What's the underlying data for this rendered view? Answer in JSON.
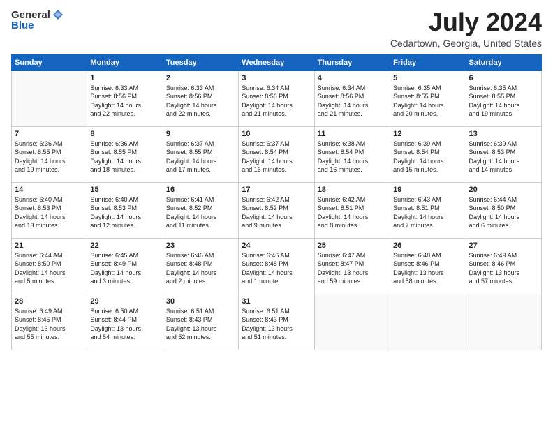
{
  "logo": {
    "general": "General",
    "blue": "Blue"
  },
  "header": {
    "month": "July 2024",
    "location": "Cedartown, Georgia, United States"
  },
  "weekdays": [
    "Sunday",
    "Monday",
    "Tuesday",
    "Wednesday",
    "Thursday",
    "Friday",
    "Saturday"
  ],
  "weeks": [
    [
      {
        "day": "",
        "info": ""
      },
      {
        "day": "1",
        "info": "Sunrise: 6:33 AM\nSunset: 8:56 PM\nDaylight: 14 hours\nand 22 minutes."
      },
      {
        "day": "2",
        "info": "Sunrise: 6:33 AM\nSunset: 8:56 PM\nDaylight: 14 hours\nand 22 minutes."
      },
      {
        "day": "3",
        "info": "Sunrise: 6:34 AM\nSunset: 8:56 PM\nDaylight: 14 hours\nand 21 minutes."
      },
      {
        "day": "4",
        "info": "Sunrise: 6:34 AM\nSunset: 8:56 PM\nDaylight: 14 hours\nand 21 minutes."
      },
      {
        "day": "5",
        "info": "Sunrise: 6:35 AM\nSunset: 8:55 PM\nDaylight: 14 hours\nand 20 minutes."
      },
      {
        "day": "6",
        "info": "Sunrise: 6:35 AM\nSunset: 8:55 PM\nDaylight: 14 hours\nand 19 minutes."
      }
    ],
    [
      {
        "day": "7",
        "info": "Sunrise: 6:36 AM\nSunset: 8:55 PM\nDaylight: 14 hours\nand 19 minutes."
      },
      {
        "day": "8",
        "info": "Sunrise: 6:36 AM\nSunset: 8:55 PM\nDaylight: 14 hours\nand 18 minutes."
      },
      {
        "day": "9",
        "info": "Sunrise: 6:37 AM\nSunset: 8:55 PM\nDaylight: 14 hours\nand 17 minutes."
      },
      {
        "day": "10",
        "info": "Sunrise: 6:37 AM\nSunset: 8:54 PM\nDaylight: 14 hours\nand 16 minutes."
      },
      {
        "day": "11",
        "info": "Sunrise: 6:38 AM\nSunset: 8:54 PM\nDaylight: 14 hours\nand 16 minutes."
      },
      {
        "day": "12",
        "info": "Sunrise: 6:39 AM\nSunset: 8:54 PM\nDaylight: 14 hours\nand 15 minutes."
      },
      {
        "day": "13",
        "info": "Sunrise: 6:39 AM\nSunset: 8:53 PM\nDaylight: 14 hours\nand 14 minutes."
      }
    ],
    [
      {
        "day": "14",
        "info": "Sunrise: 6:40 AM\nSunset: 8:53 PM\nDaylight: 14 hours\nand 13 minutes."
      },
      {
        "day": "15",
        "info": "Sunrise: 6:40 AM\nSunset: 8:53 PM\nDaylight: 14 hours\nand 12 minutes."
      },
      {
        "day": "16",
        "info": "Sunrise: 6:41 AM\nSunset: 8:52 PM\nDaylight: 14 hours\nand 11 minutes."
      },
      {
        "day": "17",
        "info": "Sunrise: 6:42 AM\nSunset: 8:52 PM\nDaylight: 14 hours\nand 9 minutes."
      },
      {
        "day": "18",
        "info": "Sunrise: 6:42 AM\nSunset: 8:51 PM\nDaylight: 14 hours\nand 8 minutes."
      },
      {
        "day": "19",
        "info": "Sunrise: 6:43 AM\nSunset: 8:51 PM\nDaylight: 14 hours\nand 7 minutes."
      },
      {
        "day": "20",
        "info": "Sunrise: 6:44 AM\nSunset: 8:50 PM\nDaylight: 14 hours\nand 6 minutes."
      }
    ],
    [
      {
        "day": "21",
        "info": "Sunrise: 6:44 AM\nSunset: 8:50 PM\nDaylight: 14 hours\nand 5 minutes."
      },
      {
        "day": "22",
        "info": "Sunrise: 6:45 AM\nSunset: 8:49 PM\nDaylight: 14 hours\nand 3 minutes."
      },
      {
        "day": "23",
        "info": "Sunrise: 6:46 AM\nSunset: 8:48 PM\nDaylight: 14 hours\nand 2 minutes."
      },
      {
        "day": "24",
        "info": "Sunrise: 6:46 AM\nSunset: 8:48 PM\nDaylight: 14 hours\nand 1 minute."
      },
      {
        "day": "25",
        "info": "Sunrise: 6:47 AM\nSunset: 8:47 PM\nDaylight: 13 hours\nand 59 minutes."
      },
      {
        "day": "26",
        "info": "Sunrise: 6:48 AM\nSunset: 8:46 PM\nDaylight: 13 hours\nand 58 minutes."
      },
      {
        "day": "27",
        "info": "Sunrise: 6:49 AM\nSunset: 8:46 PM\nDaylight: 13 hours\nand 57 minutes."
      }
    ],
    [
      {
        "day": "28",
        "info": "Sunrise: 6:49 AM\nSunset: 8:45 PM\nDaylight: 13 hours\nand 55 minutes."
      },
      {
        "day": "29",
        "info": "Sunrise: 6:50 AM\nSunset: 8:44 PM\nDaylight: 13 hours\nand 54 minutes."
      },
      {
        "day": "30",
        "info": "Sunrise: 6:51 AM\nSunset: 8:43 PM\nDaylight: 13 hours\nand 52 minutes."
      },
      {
        "day": "31",
        "info": "Sunrise: 6:51 AM\nSunset: 8:43 PM\nDaylight: 13 hours\nand 51 minutes."
      },
      {
        "day": "",
        "info": ""
      },
      {
        "day": "",
        "info": ""
      },
      {
        "day": "",
        "info": ""
      }
    ]
  ]
}
